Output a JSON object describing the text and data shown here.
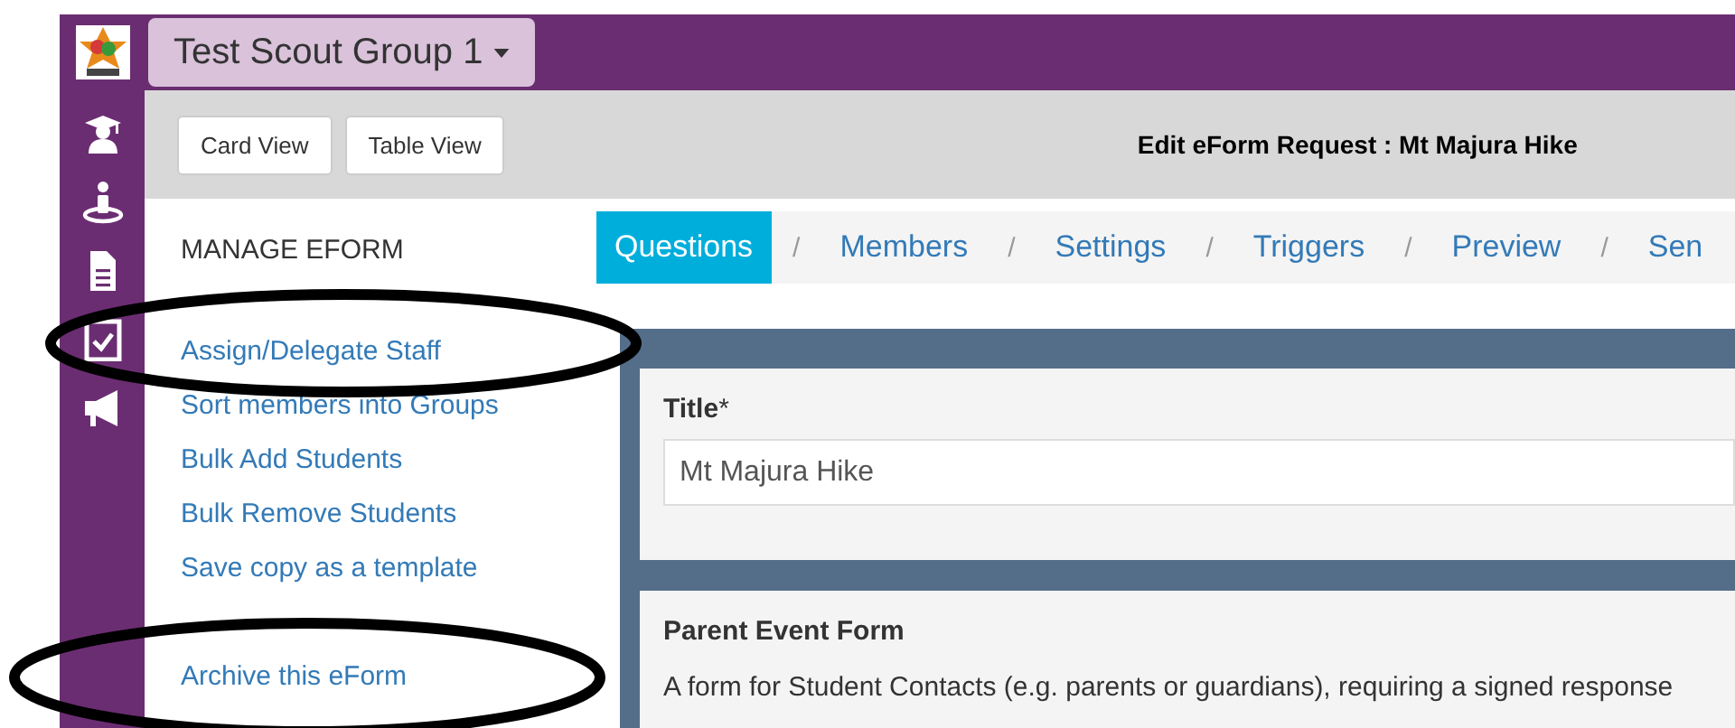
{
  "group_selector": {
    "label": "Test Scout Group 1"
  },
  "sidebar": {
    "items": [
      {
        "kind": "cap"
      },
      {
        "kind": "person"
      },
      {
        "kind": "doc"
      },
      {
        "kind": "check"
      },
      {
        "kind": "megaphone"
      }
    ]
  },
  "view_buttons": [
    {
      "label": "Card View"
    },
    {
      "label": "Table View"
    }
  ],
  "page_title": "Edit eForm Request : Mt Majura Hike",
  "manage_menu": {
    "heading": "MANAGE EFORM",
    "links": [
      "Assign/Delegate Staff",
      "Sort members into Groups",
      "Bulk Add Students",
      "Bulk Remove Students",
      "Save copy as a template",
      "Archive this eForm"
    ]
  },
  "tabs": [
    {
      "label": "Questions",
      "selected": true
    },
    {
      "label": "Members",
      "selected": false
    },
    {
      "label": "Settings",
      "selected": false
    },
    {
      "label": "Triggers",
      "selected": false
    },
    {
      "label": "Preview",
      "selected": false
    },
    {
      "label": "Sen",
      "selected": false
    }
  ],
  "tab_separator": "/",
  "title_field": {
    "label": "Title",
    "required_mark": "*",
    "value": "Mt Majura Hike"
  },
  "form_card": {
    "heading": "Parent Event Form",
    "description": "A form for Student Contacts (e.g. parents or guardians), requiring a signed response"
  },
  "annotations": [
    {
      "kind": "ellipse"
    },
    {
      "kind": "ellipse"
    }
  ]
}
